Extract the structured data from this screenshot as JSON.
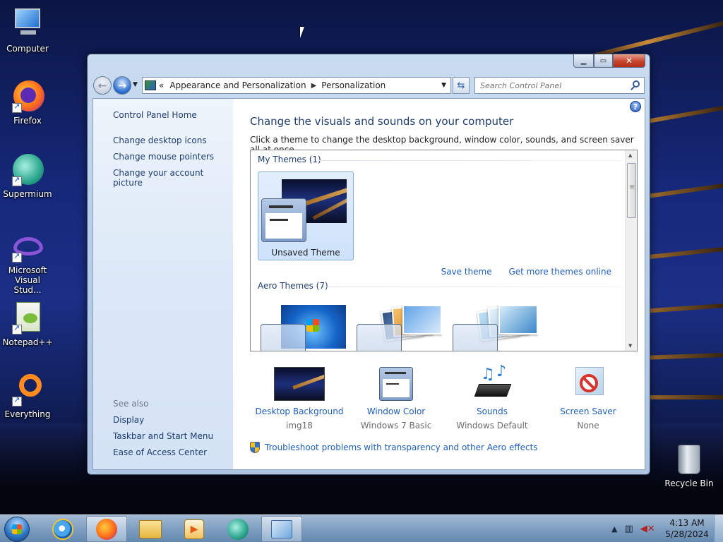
{
  "desktop": {
    "icons": [
      {
        "label": "Computer"
      },
      {
        "label": "Firefox"
      },
      {
        "label": "Supermium"
      },
      {
        "label": "Microsoft Visual Stud..."
      },
      {
        "label": "Notepad++"
      },
      {
        "label": "Everything"
      }
    ],
    "recycle_bin": "Recycle Bin"
  },
  "window": {
    "breadcrumb_prefix": "«",
    "breadcrumb": [
      "Appearance and Personalization",
      "Personalization"
    ],
    "search_placeholder": "Search Control Panel",
    "help": "?",
    "left_pane": {
      "home": "Control Panel Home",
      "tasks": [
        "Change desktop icons",
        "Change mouse pointers",
        "Change your account picture"
      ],
      "see_also_label": "See also",
      "see_also": [
        "Display",
        "Taskbar and Start Menu",
        "Ease of Access Center"
      ]
    },
    "heading": "Change the visuals and sounds on your computer",
    "subtext": "Click a theme to change the desktop background, window color, sounds, and screen saver all at once.",
    "my_themes_title": "My Themes (1)",
    "my_theme_name": "Unsaved Theme",
    "save_theme": "Save theme",
    "get_more": "Get more themes online",
    "aero_themes_title": "Aero Themes (7)",
    "bottom": [
      {
        "title": "Desktop Background",
        "value": "img18"
      },
      {
        "title": "Window Color",
        "value": "Windows 7 Basic"
      },
      {
        "title": "Sounds",
        "value": "Windows Default"
      },
      {
        "title": "Screen Saver",
        "value": "None"
      }
    ],
    "troubleshoot": "Troubleshoot problems with transparency and other Aero effects"
  },
  "taskbar": {
    "time": "4:13 AM",
    "date": "5/28/2024",
    "tray_arrow": "▲"
  }
}
